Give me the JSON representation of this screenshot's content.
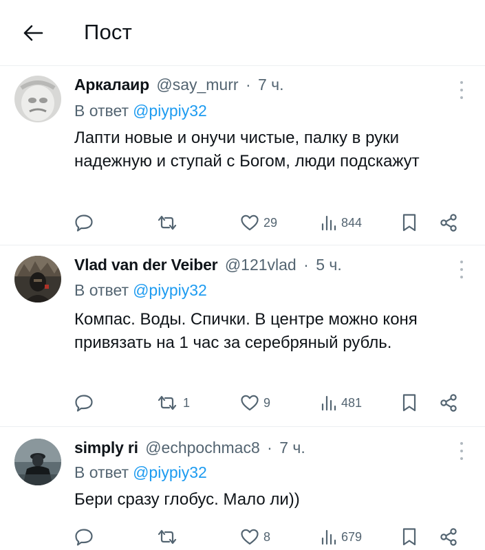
{
  "header": {
    "back_icon": "arrow-left-icon",
    "title": "Пост"
  },
  "reply_prefix": "В ответ",
  "tweets": [
    {
      "name": "Аркалаир",
      "handle": "@say_murr",
      "separator": "·",
      "time": "7 ч.",
      "reply_to": "@piypiy32",
      "text": "Лапти новые и онучи чистые, палку в руки надежную и ступай с Богом, люди подскажут",
      "replies": "",
      "retweets": "",
      "likes": "29",
      "views": "844"
    },
    {
      "name": "Vlad van der Veiber",
      "handle": "@121vlad",
      "separator": "·",
      "time": "5 ч.",
      "reply_to": "@piypiy32",
      "text": "Компас. Воды. Спички. В центре можно коня привязать на 1 час за серебряный рубль.",
      "replies": "",
      "retweets": "1",
      "likes": "9",
      "views": "481"
    },
    {
      "name": "simply ri",
      "handle": "@echpochmac8",
      "separator": "·",
      "time": "7 ч.",
      "reply_to": "@piypiy32",
      "text": "Бери сразу глобус. Мало ли))",
      "replies": "",
      "retweets": "",
      "likes": "8",
      "views": "679"
    }
  ],
  "colors": {
    "text": "#0f1419",
    "secondary": "#536471",
    "accent": "#1d9bf0",
    "divider": "#eceff1"
  }
}
